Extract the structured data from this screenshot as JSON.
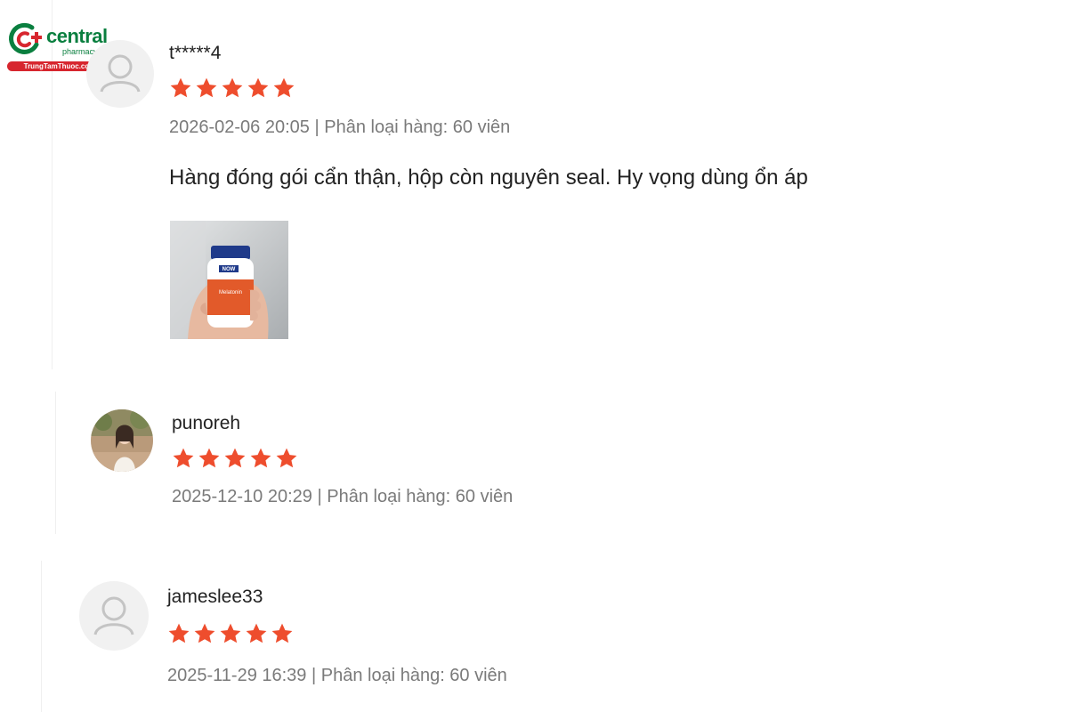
{
  "brand": {
    "name": "central",
    "tagline": "pharmacy",
    "site": "TrungTamThuoc.com",
    "colors": {
      "green": "#0a7f3f",
      "red": "#d7262e"
    }
  },
  "reviews": [
    {
      "username": "t*****4",
      "rating": 5,
      "date": "2026-02-06 20:05",
      "variant_text": "Phân loại hàng: 60 viên",
      "comment": "Hàng đóng gói cẩn thận, hộp còn nguyên seal. Hy vọng dùng ổn áp",
      "avatar": "default-user-icon",
      "photo": {
        "brand_label": "NOW",
        "product_label": "Melatonin"
      }
    },
    {
      "username": "punoreh",
      "rating": 5,
      "date": "2025-12-10 20:29",
      "variant_text": "Phân loại hàng: 60 viên",
      "avatar": "user-photo"
    },
    {
      "username": "jameslee33",
      "rating": 5,
      "date": "2025-11-29 16:39",
      "variant_text": "Phân loại hàng: 60 viên",
      "avatar": "default-user-icon"
    }
  ],
  "star_color": "#ee4d2d"
}
